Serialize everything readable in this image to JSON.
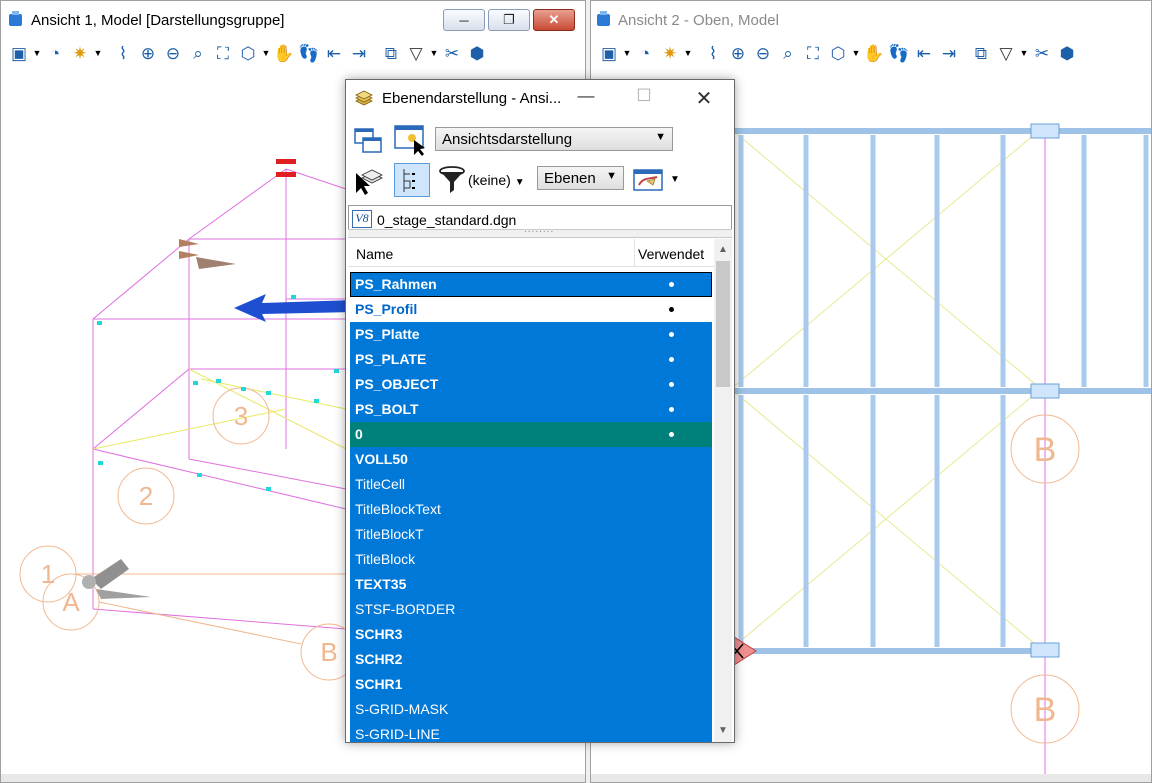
{
  "view1": {
    "title": "Ansicht 1, Model [Darstellungsgruppe]",
    "buttons": {
      "minimize": "─",
      "restore": "❐",
      "close": "✕"
    },
    "grid_labels": {
      "c1": "1",
      "c2": "2",
      "c3": "3",
      "cA": "A",
      "cB": "B"
    }
  },
  "view2": {
    "title": "Ansicht 2 - Oben, Model",
    "grid_labels": {
      "b1": "B",
      "b2": "B"
    }
  },
  "dialog": {
    "title": "Ebenendarstellung - Ansi...",
    "controls": {
      "minimize": "—",
      "maximize": "☐",
      "close": "✕"
    },
    "view_combo": "Ansichtsdarstellung",
    "filter_text": "(keine)",
    "ebenen_combo": "Ebenen",
    "file_icon_label": "V8",
    "file_name": "0_stage_standard.dgn",
    "columns": {
      "name": "Name",
      "used": "Verwendet"
    },
    "levels": [
      {
        "name": "PS_Rahmen",
        "used": true
      },
      {
        "name": "PS_Profil",
        "used": true
      },
      {
        "name": "PS_Platte",
        "used": true
      },
      {
        "name": "PS_PLATE",
        "used": true
      },
      {
        "name": "PS_OBJECT",
        "used": true
      },
      {
        "name": "PS_BOLT",
        "used": true
      },
      {
        "name": "0",
        "used": true
      },
      {
        "name": "VOLL50",
        "used": false
      },
      {
        "name": "TitleCell",
        "used": false
      },
      {
        "name": "TitleBlockText",
        "used": false
      },
      {
        "name": "TitleBlockT",
        "used": false
      },
      {
        "name": "TitleBlock",
        "used": false
      },
      {
        "name": "TEXT35",
        "used": false
      },
      {
        "name": "STSF-BORDER",
        "used": false
      },
      {
        "name": "SCHR3",
        "used": false
      },
      {
        "name": "SCHR2",
        "used": false
      },
      {
        "name": "SCHR1",
        "used": false
      },
      {
        "name": "S-GRID-MASK",
        "used": false
      },
      {
        "name": "S-GRID-LINE",
        "used": false
      }
    ]
  },
  "colors": {
    "selection": "#0078d7",
    "active_row": "#00807a",
    "arrow": "#1f4fd1"
  }
}
